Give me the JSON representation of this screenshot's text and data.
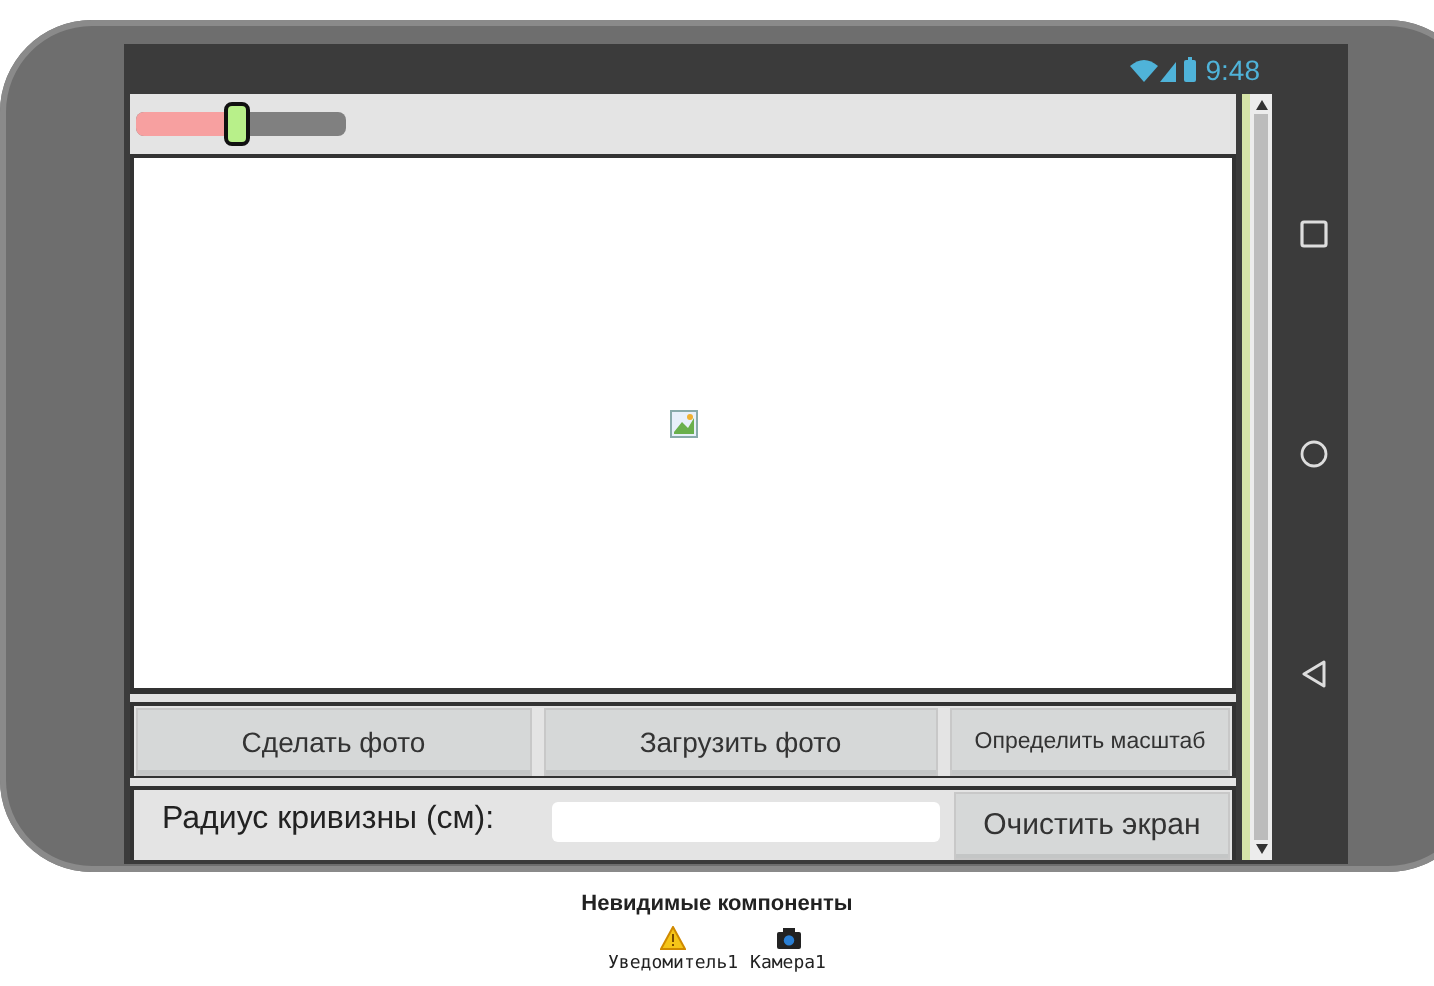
{
  "status_bar": {
    "time": "9:48"
  },
  "slider": {
    "level": 0.48
  },
  "button_row": [
    {
      "label": "Сделать фото"
    },
    {
      "label": "Загрузить фото"
    },
    {
      "label": "Определить масштаб"
    }
  ],
  "radius_row": {
    "label": "Радиус кривизны (см):",
    "button": "Очистить экран"
  },
  "non_visible_components": {
    "title": "Невидимые компоненты",
    "items": [
      {
        "label": "Уведомитель1",
        "kind": "notifier"
      },
      {
        "label": "Камера1",
        "kind": "camera"
      }
    ]
  }
}
